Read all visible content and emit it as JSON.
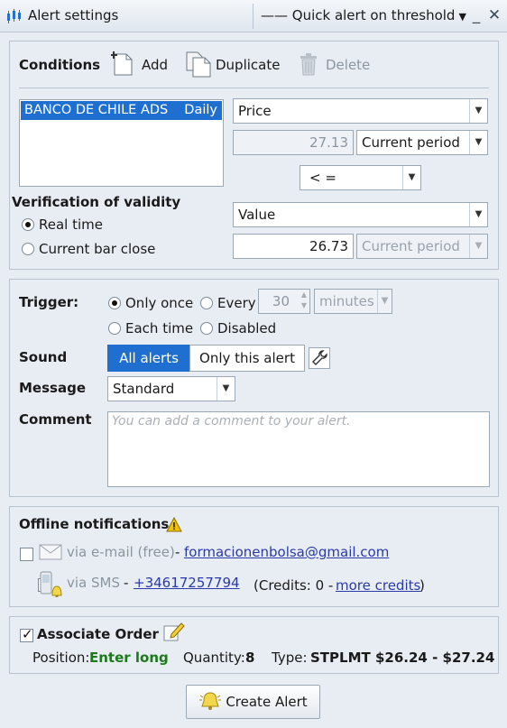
{
  "window": {
    "title": "Alert settings",
    "alert_type": "—— Quick alert on threshold",
    "minimize_label": "_",
    "close_label": "✕"
  },
  "conditions": {
    "heading": "Conditions",
    "add_label": "Add",
    "duplicate_label": "Duplicate",
    "delete_label": "Delete",
    "list": [
      {
        "name": "BANCO DE CHILE ADS",
        "timeframe": "Daily",
        "selected": true
      }
    ],
    "price_select": "Price",
    "price_value": "27.13",
    "price_period": "Current period",
    "operator": "< =",
    "value_select": "Value",
    "threshold_value": "26.73",
    "threshold_period": "Current period"
  },
  "validity": {
    "heading": "Verification of validity",
    "option_realtime": "Real time",
    "option_barclose": "Current bar close",
    "selected": "Real time"
  },
  "trigger": {
    "label": "Trigger:",
    "only_once": "Only once",
    "every": "Every",
    "every_value": "30",
    "every_unit": "minutes",
    "each_time": "Each time",
    "disabled": "Disabled",
    "selected": "Only once"
  },
  "sound": {
    "label": "Sound",
    "all_alerts": "All alerts",
    "only_this": "Only this alert",
    "selected": "All alerts"
  },
  "message": {
    "label": "Message",
    "value": "Standard"
  },
  "comment": {
    "label": "Comment",
    "placeholder": "You can add a comment to your alert."
  },
  "offline": {
    "heading": "Offline notifications",
    "email_label": "via e-mail (free)",
    "email_dash": "-",
    "email_address": "formacionenbolsa@gmail.com",
    "sms_label": "via SMS",
    "sms_dash": "-",
    "sms_number": "+34617257794",
    "credits_prefix": "(Credits: 0 -",
    "more_credits": "more credits",
    "credits_suffix": ")"
  },
  "order": {
    "label": "Associate Order",
    "checked": true,
    "position_label": "Position:",
    "position_value": "Enter long",
    "quantity_label": "Quantity:",
    "quantity_value": "8",
    "type_label": "Type:",
    "type_value": "STPLMT $26.24 - $27.24"
  },
  "footer": {
    "create_label": "Create Alert"
  },
  "colors": {
    "accent": "#1f6fd1",
    "position_green": "#1c7a1c",
    "link": "#2a3aa8",
    "warning": "#f2c200"
  }
}
